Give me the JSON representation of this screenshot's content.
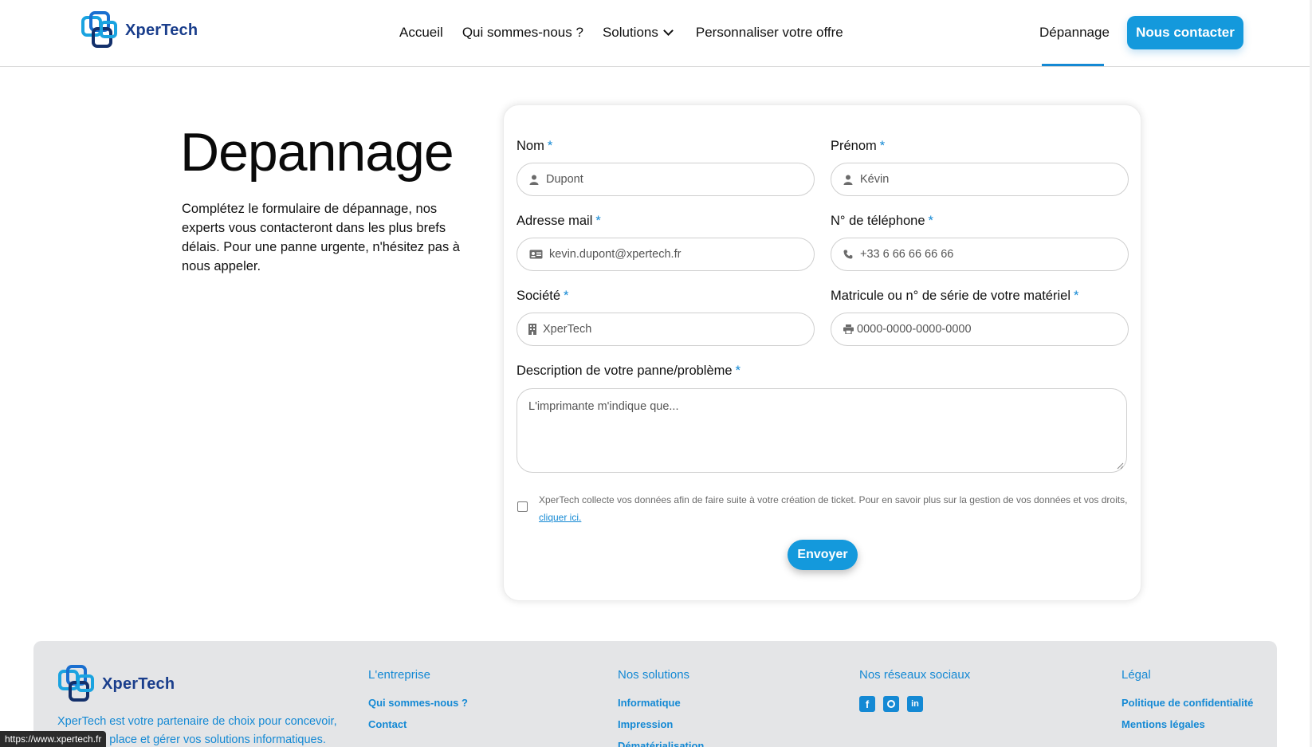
{
  "header": {
    "logo_text": "XperTech",
    "nav": [
      "Accueil",
      "Qui sommes-nous ?",
      "Solutions",
      "Personnaliser votre offre"
    ],
    "depannage": "Dépannage",
    "contact_button": "Nous contacter"
  },
  "intro": {
    "title": "Depannage",
    "text": "Complétez le formulaire de dépannage, nos experts vous contacteront dans les plus brefs délais. Pour une panne urgente, n'hésitez pas à nous appeler."
  },
  "form": {
    "required_mark": "*",
    "nom": {
      "label": "Nom",
      "placeholder": "Dupont",
      "icon": "user-icon"
    },
    "prenom": {
      "label": "Prénom",
      "placeholder": "Kévin",
      "icon": "user-icon"
    },
    "email": {
      "label": "Adresse mail",
      "placeholder": "kevin.dupont@xpertech.fr",
      "icon": "id-card-icon"
    },
    "phone": {
      "label": "N° de téléphone",
      "placeholder": "+33 6 66 66 66 66",
      "icon": "phone-icon"
    },
    "societe": {
      "label": "Société",
      "placeholder": "XperTech",
      "icon": "building-icon"
    },
    "serial": {
      "label": "Matricule ou n° de série de votre matériel",
      "placeholder": "0000-0000-0000-0000",
      "icon": "printer-icon"
    },
    "description": {
      "label": "Description de votre panne/problème",
      "placeholder": "L'imprimante m'indique que..."
    },
    "consent_text": "XperTech collecte vos données afin de faire suite à votre création de ticket. Pour en savoir plus sur la gestion de vos données et vos droits, ",
    "consent_link": "cliquer ici.",
    "submit": "Envoyer"
  },
  "footer": {
    "logo_text": "XperTech",
    "description": "XperTech est votre partenaire de choix pour concevoir, mettre en place et gérer vos solutions informatiques.",
    "col_entreprise": {
      "title": "L'entreprise",
      "links": [
        "Qui sommes-nous ?",
        "Contact"
      ]
    },
    "col_solutions": {
      "title": "Nos solutions",
      "links": [
        "Informatique",
        "Impression",
        "Dématérialisation"
      ]
    },
    "col_social": {
      "title": "Nos réseaux sociaux",
      "icons": [
        "facebook-icon",
        "instagram-icon",
        "linkedin-icon"
      ]
    },
    "col_legal": {
      "title": "Légal",
      "links": [
        "Politique de confidentialité",
        "Mentions légales"
      ]
    }
  },
  "status_url": "https://www.xpertech.fr",
  "colors": {
    "accent": "#1499dc",
    "brand_dark": "#1a3e8c",
    "footer_bg": "#e4e5e7"
  }
}
